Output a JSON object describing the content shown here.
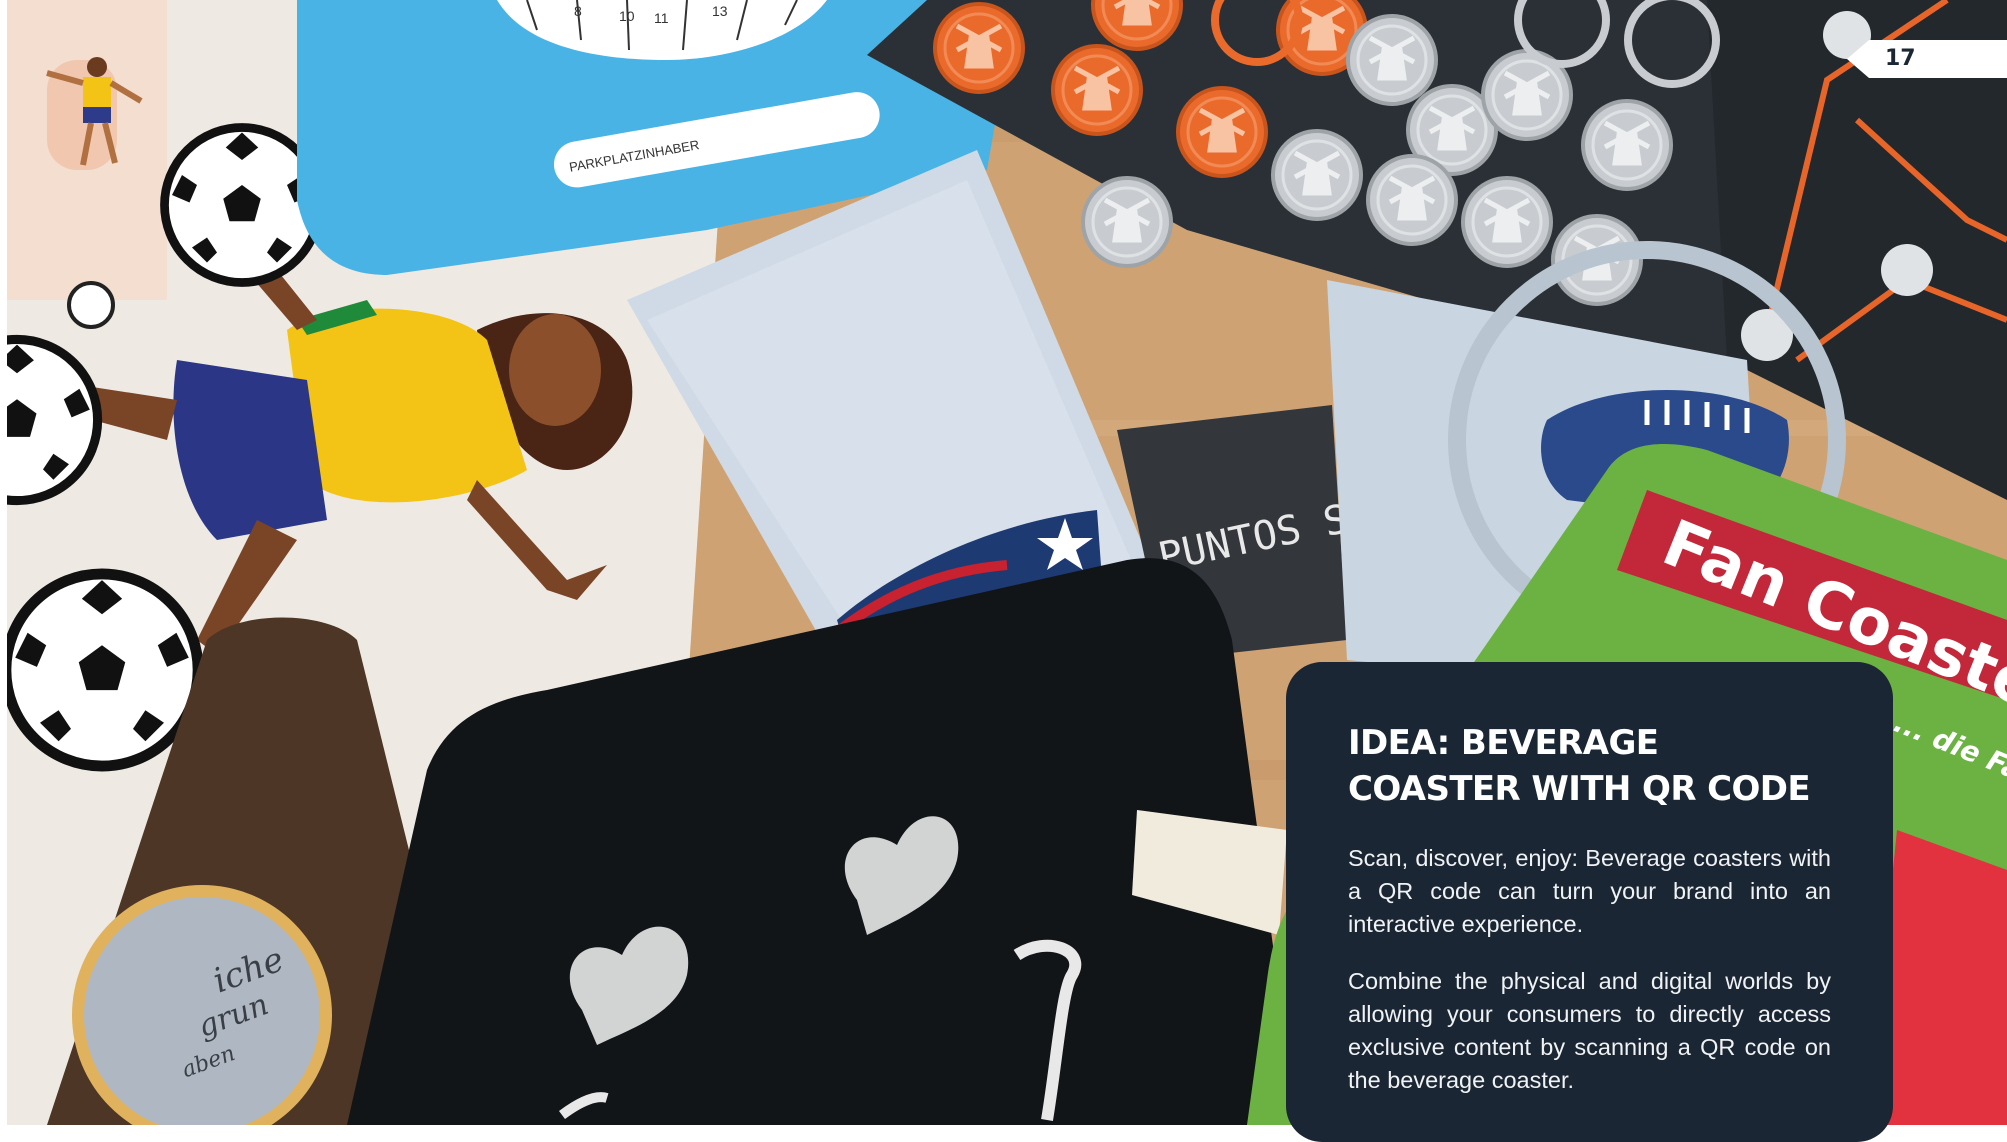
{
  "page": {
    "number": "17"
  },
  "idea_box": {
    "title": "IDEA: BEVERAGE COASTER WITH QR CODE",
    "paragraphs": [
      "Scan, discover, enjoy: Beverage coasters with a QR code can turn your brand into an interactive experience.",
      "Combine the physical and digital worlds by allowing your consumers to directly access exclusive content by scanning a QR code on the beverage coaster."
    ]
  },
  "photo_text": {
    "parking_label": "PARKPLATZINHABER",
    "dial_numbers": [
      "8",
      "10",
      "11",
      "13"
    ],
    "sticker_text": "PUNTOS SE",
    "green_coaster_text": "Fan Coaster",
    "green_coaster_subtext": "... die Fa",
    "round_coaster_text": [
      "iche",
      "grun",
      "aben"
    ]
  },
  "colors": {
    "panel": "#1a2633",
    "wood": "#cfa274",
    "orange_token": "#ea6a2c",
    "sky_blue_coaster": "#4ab3e6",
    "green_coaster": "#6bb243",
    "chalkboard": "#121518"
  }
}
